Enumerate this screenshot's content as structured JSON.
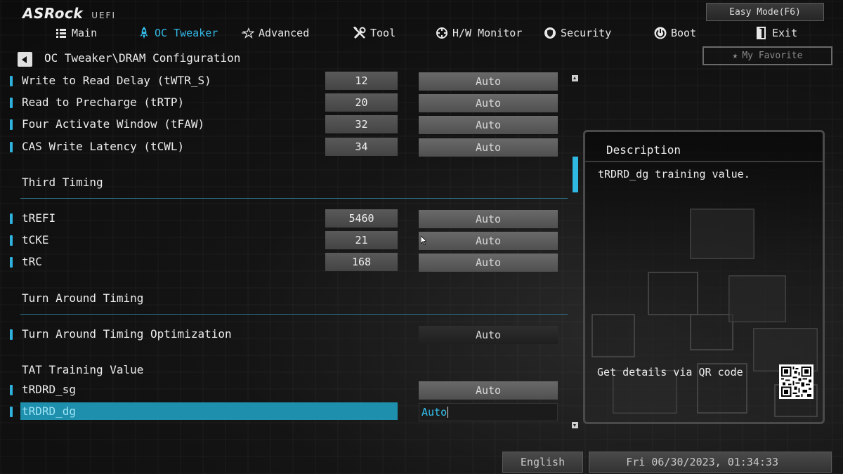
{
  "header": {
    "brand": "ASRock",
    "product": "UEFI",
    "easy_mode_label": "Easy Mode(F6)"
  },
  "nav": [
    {
      "label": "Main",
      "icon": "list-icon",
      "active": false
    },
    {
      "label": "OC Tweaker",
      "icon": "rocket-icon",
      "active": true
    },
    {
      "label": "Advanced",
      "icon": "star-icon",
      "active": false
    },
    {
      "label": "Tool",
      "icon": "tools-icon",
      "active": false
    },
    {
      "label": "H/W Monitor",
      "icon": "crosshair-icon",
      "active": false
    },
    {
      "label": "Security",
      "icon": "shield-icon",
      "active": false
    },
    {
      "label": "Boot",
      "icon": "power-icon",
      "active": false
    },
    {
      "label": "Exit",
      "icon": "exit-icon",
      "active": false
    }
  ],
  "breadcrumb": "OC Tweaker\\DRAM Configuration",
  "favorite_label": "My Favorite",
  "settings": {
    "twtr_s": {
      "label": "Write to Read Delay (tWTR_S)",
      "value": "12",
      "option": "Auto"
    },
    "trtp": {
      "label": "Read to Precharge (tRTP)",
      "value": "20",
      "option": "Auto"
    },
    "tfaw": {
      "label": "Four Activate Window (tFAW)",
      "value": "32",
      "option": "Auto"
    },
    "tcwl": {
      "label": "CAS Write Latency (tCWL)",
      "value": "34",
      "option": "Auto"
    },
    "third_timing": "Third Timing",
    "trefi": {
      "label": "tREFI",
      "value": "5460",
      "option": "Auto"
    },
    "tcke": {
      "label": "tCKE",
      "value": "21",
      "option": "Auto"
    },
    "trc": {
      "label": "tRC",
      "value": "168",
      "option": "Auto"
    },
    "turn_around_timing": "Turn Around Timing",
    "tat_opt": {
      "label": "Turn Around Timing Optimization",
      "option": "Auto"
    },
    "tat_training_value": "TAT Training Value",
    "trdrd_sg": {
      "label": "tRDRD_sg",
      "option": "Auto"
    },
    "trdrd_dg": {
      "label": "tRDRD_dg",
      "option": "Auto"
    }
  },
  "description": {
    "title": "Description",
    "text": "tRDRD_dg training value.",
    "qr_label": "Get details via QR code"
  },
  "footer": {
    "language": "English",
    "datetime": "Fri 06/30/2023, 01:34:33"
  },
  "colors": {
    "accent": "#2fb2de",
    "selected_row": "#1e8fac",
    "background": "#101010"
  }
}
